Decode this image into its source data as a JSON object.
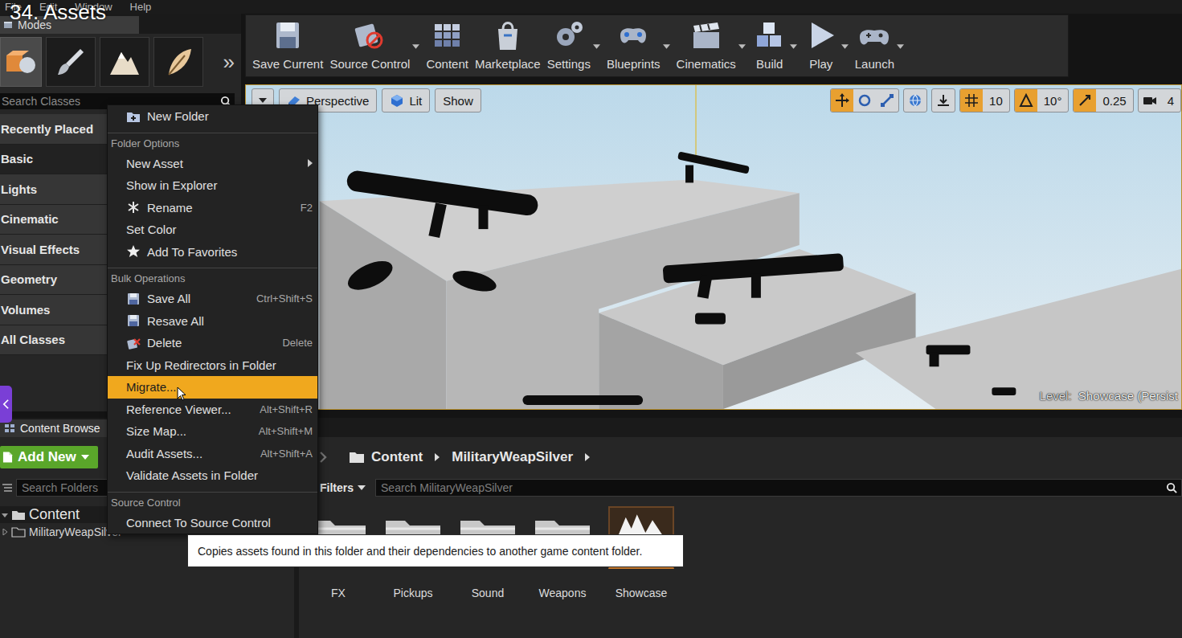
{
  "overlay_title": "34. Assets",
  "menubar": [
    "File",
    "Edit",
    "Window",
    "Help"
  ],
  "modes": {
    "tab": "Modes",
    "more": "»",
    "tools": [
      {
        "selected": true
      },
      {
        "selected": false
      },
      {
        "selected": false
      },
      {
        "selected": false
      }
    ]
  },
  "place_panel": {
    "search_placeholder": "Search Classes",
    "categories": [
      {
        "label": "Recently Placed",
        "selected": false
      },
      {
        "label": "Basic",
        "selected": true
      },
      {
        "label": "Lights",
        "selected": false
      },
      {
        "label": "Cinematic",
        "selected": false
      },
      {
        "label": "Visual Effects",
        "selected": false
      },
      {
        "label": "Geometry",
        "selected": false
      },
      {
        "label": "Volumes",
        "selected": false
      },
      {
        "label": "All Classes",
        "selected": false
      }
    ]
  },
  "toolbar": [
    {
      "label": "Save Current",
      "dropdown": false
    },
    {
      "label": "Source Control",
      "dropdown": true
    },
    {
      "label": "Content",
      "dropdown": false
    },
    {
      "label": "Marketplace",
      "dropdown": false
    },
    {
      "label": "Settings",
      "dropdown": true
    },
    {
      "label": "Blueprints",
      "dropdown": true
    },
    {
      "label": "Cinematics",
      "dropdown": true
    },
    {
      "label": "Build",
      "dropdown": true
    },
    {
      "label": "Play",
      "dropdown": true
    },
    {
      "label": "Launch",
      "dropdown": true
    }
  ],
  "viewport": {
    "view_mode": "Perspective",
    "lighting": "Lit",
    "show": "Show",
    "transform_tools": [
      {
        "selected": true
      },
      {
        "selected": false
      },
      {
        "selected": false
      }
    ],
    "snaps": [
      {
        "value": "10",
        "on": true
      },
      {
        "value": "10°",
        "on": true
      },
      {
        "value": "0.25",
        "on": true
      }
    ],
    "camera_speed": "4",
    "level_label": "Level:",
    "level_name": "Showcase (Persist"
  },
  "context_menu": [
    {
      "kind": "create",
      "label": "New Folder",
      "shortcut": "",
      "submenu": false,
      "highlighted": false
    },
    {
      "kind": "header",
      "label": "Folder Options"
    },
    {
      "kind": "plain",
      "label": "New Asset",
      "shortcut": "",
      "submenu": true,
      "highlighted": false
    },
    {
      "kind": "plain",
      "label": "Show in Explorer",
      "shortcut": "",
      "submenu": false,
      "highlighted": false
    },
    {
      "kind": "rename",
      "label": "Rename",
      "shortcut": "F2",
      "submenu": false,
      "highlighted": false
    },
    {
      "kind": "plain",
      "label": "Set Color",
      "shortcut": "",
      "submenu": false,
      "highlighted": false
    },
    {
      "kind": "favorite",
      "label": "Add To Favorites",
      "shortcut": "",
      "submenu": false,
      "highlighted": false
    },
    {
      "kind": "header",
      "label": "Bulk Operations"
    },
    {
      "kind": "save",
      "label": "Save All",
      "shortcut": "Ctrl+Shift+S",
      "submenu": false,
      "highlighted": false
    },
    {
      "kind": "save",
      "label": "Resave All",
      "shortcut": "",
      "submenu": false,
      "highlighted": false
    },
    {
      "kind": "delete",
      "label": "Delete",
      "shortcut": "Delete",
      "submenu": false,
      "highlighted": false
    },
    {
      "kind": "plain",
      "label": "Fix Up Redirectors in Folder",
      "shortcut": "",
      "submenu": false,
      "highlighted": false
    },
    {
      "kind": "plain",
      "label": "Migrate...",
      "shortcut": "",
      "submenu": false,
      "highlighted": true
    },
    {
      "kind": "plain",
      "label": "Reference Viewer...",
      "shortcut": "Alt+Shift+R",
      "submenu": false,
      "highlighted": false
    },
    {
      "kind": "plain",
      "label": "Size Map...",
      "shortcut": "Alt+Shift+M",
      "submenu": false,
      "highlighted": false
    },
    {
      "kind": "plain",
      "label": "Audit Assets...",
      "shortcut": "Alt+Shift+A",
      "submenu": false,
      "highlighted": false
    },
    {
      "kind": "plain",
      "label": "Validate Assets in Folder",
      "shortcut": "",
      "submenu": false,
      "highlighted": false
    },
    {
      "kind": "header",
      "label": "Source Control"
    },
    {
      "kind": "plain",
      "label": "Connect To Source Control",
      "shortcut": "",
      "submenu": false,
      "highlighted": false
    }
  ],
  "tooltip": "Copies assets found in this folder and their dependencies to another game content folder.",
  "content_browser": {
    "tab": "Content Browse",
    "add_new": "Add New",
    "path": [
      "Content",
      "MilitaryWeapSilver"
    ],
    "search_folders_placeholder": "Search Folders",
    "filters": "Filters",
    "search_assets_placeholder": "Search MilitaryWeapSilver",
    "tree": [
      {
        "label": "Content",
        "expanded": true,
        "children": [
          {
            "label": "MilitaryWeapSilver",
            "expanded": false
          }
        ]
      }
    ],
    "assets": [
      {
        "label": "FX",
        "kind": "folder"
      },
      {
        "label": "Pickups",
        "kind": "folder"
      },
      {
        "label": "Sound",
        "kind": "folder"
      },
      {
        "label": "Weapons",
        "kind": "folder"
      },
      {
        "label": "Showcase",
        "kind": "level"
      }
    ]
  }
}
